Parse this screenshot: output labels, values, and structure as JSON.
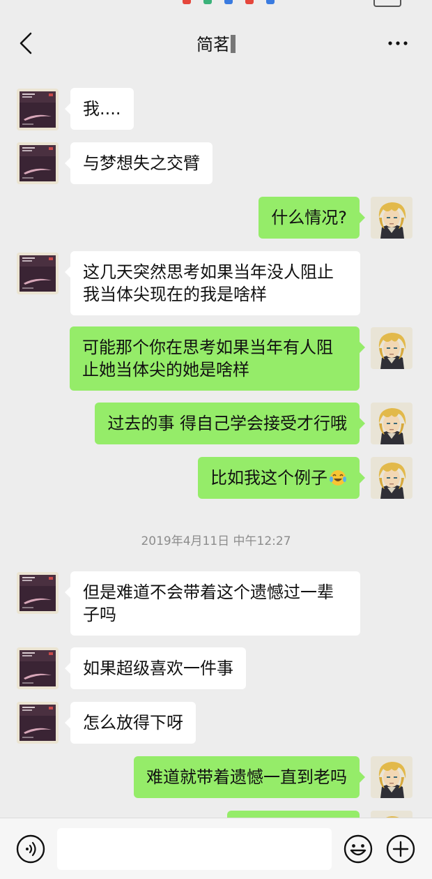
{
  "header": {
    "title": "简茗"
  },
  "messages": [
    {
      "side": "in",
      "text": "我...."
    },
    {
      "side": "in",
      "text": "与梦想失之交臂"
    },
    {
      "side": "out",
      "text": "什么情况?"
    },
    {
      "side": "in",
      "text": "这几天突然思考如果当年没人阻止\n我当体尖现在的我是啥样"
    },
    {
      "side": "out",
      "text": "可能那个你在思考如果当年有人阻\n止她当体尖的她是啥样"
    },
    {
      "side": "out",
      "text": "过去的事 得自己学会接受才行哦"
    },
    {
      "side": "out",
      "text": "比如我这个例子"
    },
    {
      "side": "in",
      "text": "但是难道不会带着这个遗憾过一辈\n子吗"
    },
    {
      "side": "in",
      "text": "如果超级喜欢一件事"
    },
    {
      "side": "in",
      "text": "怎么放得下呀"
    },
    {
      "side": "out",
      "text": "难道就带着遗憾一直到老吗"
    }
  ],
  "timestamp": "2019年4月11日 中午12:27",
  "icons": {
    "back": "chevron-left-icon",
    "more": "more-dots-icon",
    "voice": "voice-icon",
    "emoji": "smiley-icon",
    "plus": "plus-icon",
    "laugh_emoji": "tears-of-joy-emoji"
  },
  "colors": {
    "background": "#ededed",
    "bubble_in": "#ffffff",
    "bubble_out": "#95ec69",
    "timestamp": "#8c8c8c"
  }
}
